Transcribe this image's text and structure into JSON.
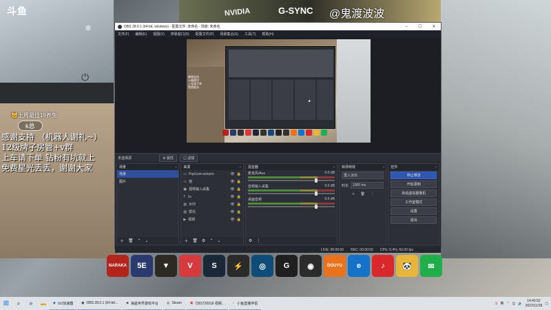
{
  "watermark": {
    "site": "斗鱼",
    "streamer": "@鬼渡波波"
  },
  "scene_text": {
    "monitor_brand": "G-SYNC",
    "nvidia": "NVIDIA"
  },
  "overlay": {
    "top": "🐱上周最佳19养兔",
    "name": "k总",
    "lines": [
      "感谢支持 （机器人谢礼~）",
      "12级牌子房管+v群",
      "上车请下单 钻粉有坑就上",
      "免费星光丢丢，谢谢大家"
    ]
  },
  "obs": {
    "title": "OBS 28.0.1 (64-bit, windows) - 配置文件: 未命名 - 场景: 未命名",
    "window_buttons": [
      "–",
      "☐",
      "✕"
    ],
    "menu": [
      "文件(F)",
      "编辑(E)",
      "视图(V)",
      "停靠窗口(D)",
      "配置文件(P)",
      "场景集合(S)",
      "工具(T)",
      "帮助(H)"
    ],
    "toolbar": {
      "no_source": "未选择源",
      "properties": "属性",
      "filters": "滤镜"
    },
    "docks": {
      "scenes": {
        "title": "场景",
        "items": [
          "场景",
          "图片"
        ]
      },
      "sources": {
        "title": "来源",
        "items": [
          "PrprLive-scharm",
          "窗",
          "视频输入采集",
          "1s",
          "水印",
          "帮托",
          "视频"
        ]
      },
      "mixer": {
        "title": "混音器",
        "tracks": [
          {
            "name": "麦克风/Aux",
            "db": "0.0 dB"
          },
          {
            "name": "音频输入采集",
            "db": "0.0 dB"
          },
          {
            "name": "桌面音频",
            "db": "0.0 dB"
          }
        ]
      },
      "transitions": {
        "title": "转场特效",
        "type": "重入淡出",
        "duration_label": "时长",
        "duration": "1000 ms"
      },
      "controls": {
        "title": "控件",
        "buttons": [
          "停止推流",
          "开始录制",
          "启动虚拟摄像机",
          "工作室模式",
          "设置",
          "退出"
        ]
      }
    },
    "status": {
      "live": "LIVE: 00:00:00",
      "rec": "REC: 00:00:00",
      "cpu": "CPU: 0.4%, 60.00 fps"
    }
  },
  "dock_apps": [
    {
      "name": "NARAKA",
      "color": "#b3241c"
    },
    {
      "name": "5E",
      "color": "#2b3a6e"
    },
    {
      "name": "▼",
      "color": "#2c2a22"
    },
    {
      "name": "V",
      "color": "#d73a3e"
    },
    {
      "name": "S",
      "color": "#1b2838"
    },
    {
      "name": "⚡",
      "color": "#2a2a2a"
    },
    {
      "name": "◎",
      "color": "#0f4c7a"
    },
    {
      "name": "G",
      "color": "#1f1f1f"
    },
    {
      "name": "◉",
      "color": "#2b2b2b"
    },
    {
      "name": "DOUYU",
      "color": "#e8731c"
    },
    {
      "name": "e",
      "color": "#1572c9"
    },
    {
      "name": "♪",
      "color": "#d8282c"
    },
    {
      "name": "🐼",
      "color": "#e6b53a"
    },
    {
      "name": "✉",
      "color": "#1fae4a"
    }
  ],
  "taskbar": {
    "tasks": [
      "UU加速器",
      "OBS 28.0.1 (64-bit...",
      "海盗世界游戏平台",
      "Steam",
      "CBS720018 视频...",
      "小鱼直播伴侣"
    ],
    "time": "14:43:52",
    "date": "2022/11/28",
    "ime": "英"
  }
}
